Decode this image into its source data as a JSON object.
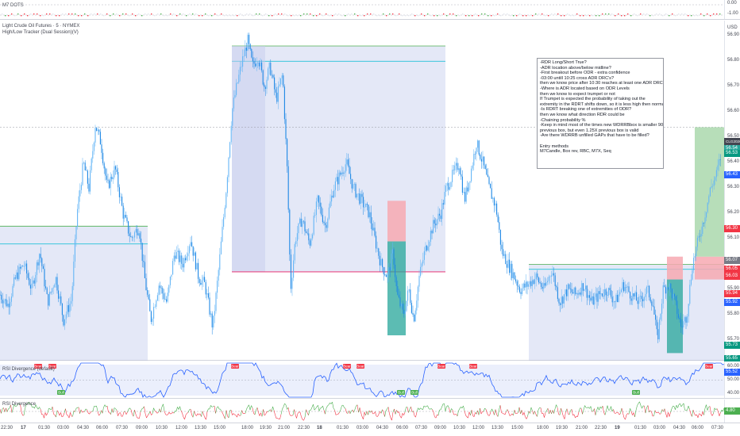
{
  "top_indicator": {
    "label": "M7 DOTS",
    "axis_ticks": [
      "0.00",
      "-1.00"
    ]
  },
  "symbol": {
    "title": "Light Crude Oil Futures · 5 · NYMEX",
    "indicator": "High/Low Tracker (Dual Session)(V)"
  },
  "price_axis": {
    "ticks": [
      "56.90",
      "56.80",
      "56.70",
      "56.60",
      "56.50",
      "56.40",
      "56.30",
      "56.20",
      "56.10",
      "56.00",
      "55.90",
      "55.80",
      "55.70"
    ],
    "unit": "USD",
    "badges": [
      {
        "text": "CLG2026",
        "color": "#434651"
      },
      {
        "text": "56.54",
        "color": "#26a69a"
      },
      {
        "text": "56.53",
        "color": "#089981"
      },
      {
        "text": "56.43",
        "color": "#2962ff"
      },
      {
        "text": "56.30",
        "color": "#f23645"
      },
      {
        "text": "56.07",
        "color": "#787b86"
      },
      {
        "text": "56.05",
        "color": "#f23645"
      },
      {
        "text": "56.03",
        "color": "#f23645"
      },
      {
        "text": "55.94",
        "color": "#f23645"
      },
      {
        "text": "55.92",
        "color": "#2962ff"
      },
      {
        "text": "55.73",
        "color": "#089981"
      },
      {
        "text": "55.65",
        "color": "#089981"
      }
    ]
  },
  "notes": [
    "-RDR Long/Short True?",
    "-ADR location above/below midline?",
    "-First breakout before ODR - extra confidence",
    "-03:00 untill 10:25 cross ADR DRC's?",
    "      then we know price after 10:30 reaches at least one ADR DRC",
    "-Where is ADR located based on ODR Levels",
    "      then we know to expect trumpet or not",
    "            If Trumpet is expected the probability of taking out the",
    "extremity in the RDRT shifts down, so it is less high then normal",
    "-Is RDRT breaking one of extremities of ODR?",
    "      then we know what direction RDR could be",
    "-Chaining probability %",
    "-Keep in mind most of the times new WDRRBbox is smaller 90% of",
    "previous box, but even 1.25X previous box is valid",
    "-Are there WDRRB unfilled GAPs that have to be filled?",
    "",
    "Entry methods",
    "M7Candle, Box rev, RBC, M7X, Seq"
  ],
  "rsi_pane": {
    "label": "RSI Divergence (default)",
    "axis_ticks": [
      "60.00",
      "50.00",
      "40.00"
    ],
    "badge_value": "55.52",
    "badge_color": "#2962ff",
    "signals": [
      {
        "text": "Bear",
        "type": "bear",
        "x": 48
      },
      {
        "text": "Bear",
        "type": "bear",
        "x": 66
      },
      {
        "text": "Bull",
        "type": "bull",
        "x": 77
      },
      {
        "text": "Bear",
        "type": "bear",
        "x": 296
      },
      {
        "text": "Bear",
        "type": "bear",
        "x": 437
      },
      {
        "text": "Bear",
        "type": "bear",
        "x": 454
      },
      {
        "text": "Bull",
        "type": "bull",
        "x": 505
      },
      {
        "text": "Bull",
        "type": "bull",
        "x": 522
      },
      {
        "text": "Bear",
        "type": "bear",
        "x": 556
      },
      {
        "text": "Bear",
        "type": "bear",
        "x": 596
      },
      {
        "text": "Bull",
        "type": "bull",
        "x": 801
      },
      {
        "text": "Bear",
        "type": "bear",
        "x": 893
      }
    ]
  },
  "rsi2_pane": {
    "label": "RSI Divergence",
    "badge_value": "4.80",
    "badge_color": "#4caf50"
  },
  "time_axis": {
    "labels": [
      {
        "text": "22:30",
        "x": 8
      },
      {
        "text": "17",
        "x": 33,
        "bold": true
      },
      {
        "text": "01:30",
        "x": 55
      },
      {
        "text": "03:00",
        "x": 79
      },
      {
        "text": "04:30",
        "x": 104
      },
      {
        "text": "06:00",
        "x": 128
      },
      {
        "text": "07:30",
        "x": 153
      },
      {
        "text": "09:00",
        "x": 178
      },
      {
        "text": "10:30",
        "x": 203
      },
      {
        "text": "12:00",
        "x": 228
      },
      {
        "text": "13:30",
        "x": 252
      },
      {
        "text": "15:00",
        "x": 276
      },
      {
        "text": "18:00",
        "x": 311
      },
      {
        "text": "19:30",
        "x": 334
      },
      {
        "text": "21:00",
        "x": 357
      },
      {
        "text": "22:30",
        "x": 382
      },
      {
        "text": "18",
        "x": 406,
        "bold": true
      },
      {
        "text": "01:30",
        "x": 431
      },
      {
        "text": "03:00",
        "x": 456
      },
      {
        "text": "04:30",
        "x": 481
      },
      {
        "text": "06:00",
        "x": 506
      },
      {
        "text": "07:30",
        "x": 530
      },
      {
        "text": "09:00",
        "x": 554
      },
      {
        "text": "10:30",
        "x": 578
      },
      {
        "text": "12:00",
        "x": 602
      },
      {
        "text": "13:30",
        "x": 626
      },
      {
        "text": "15:00",
        "x": 651
      },
      {
        "text": "18:00",
        "x": 683
      },
      {
        "text": "19:30",
        "x": 707
      },
      {
        "text": "21:00",
        "x": 732
      },
      {
        "text": "22:30",
        "x": 756
      },
      {
        "text": "19",
        "x": 781,
        "bold": true
      },
      {
        "text": "01:30",
        "x": 806
      },
      {
        "text": "03:00",
        "x": 830
      },
      {
        "text": "04:30",
        "x": 855
      },
      {
        "text": "06:00",
        "x": 878
      },
      {
        "text": "07:30",
        "x": 903
      }
    ]
  },
  "chart_data": {
    "type": "candlestick",
    "instrument": "CLG2026",
    "timeframe": "5",
    "ylim": [
      55.62,
      56.96
    ],
    "price_path": [
      [
        0,
        55.88
      ],
      [
        10,
        55.84
      ],
      [
        20,
        55.95
      ],
      [
        30,
        56.0
      ],
      [
        40,
        55.9
      ],
      [
        50,
        56.05
      ],
      [
        60,
        55.85
      ],
      [
        70,
        55.95
      ],
      [
        80,
        55.78
      ],
      [
        90,
        55.86
      ],
      [
        97,
        56.2
      ],
      [
        105,
        56.4
      ],
      [
        112,
        56.3
      ],
      [
        120,
        56.55
      ],
      [
        127,
        56.48
      ],
      [
        135,
        56.3
      ],
      [
        145,
        56.38
      ],
      [
        155,
        56.2
      ],
      [
        165,
        56.1
      ],
      [
        175,
        56.15
      ],
      [
        182,
        55.95
      ],
      [
        190,
        55.78
      ],
      [
        200,
        55.92
      ],
      [
        210,
        55.85
      ],
      [
        220,
        56.05
      ],
      [
        230,
        56.0
      ],
      [
        240,
        56.1
      ],
      [
        250,
        55.95
      ],
      [
        258,
        55.92
      ],
      [
        268,
        55.75
      ],
      [
        276,
        56.0
      ],
      [
        285,
        56.3
      ],
      [
        292,
        56.6
      ],
      [
        298,
        56.7
      ],
      [
        305,
        56.8
      ],
      [
        312,
        56.88
      ],
      [
        318,
        56.78
      ],
      [
        325,
        56.82
      ],
      [
        333,
        56.7
      ],
      [
        340,
        56.78
      ],
      [
        348,
        56.65
      ],
      [
        356,
        56.75
      ],
      [
        362,
        56.35
      ],
      [
        366,
        55.9
      ],
      [
        372,
        56.1
      ],
      [
        380,
        56.18
      ],
      [
        390,
        56.08
      ],
      [
        400,
        56.25
      ],
      [
        410,
        56.15
      ],
      [
        420,
        56.3
      ],
      [
        428,
        56.35
      ],
      [
        436,
        56.4
      ],
      [
        445,
        56.3
      ],
      [
        455,
        56.25
      ],
      [
        465,
        56.2
      ],
      [
        472,
        56.1
      ],
      [
        480,
        56.0
      ],
      [
        488,
        55.95
      ],
      [
        495,
        56.05
      ],
      [
        500,
        55.88
      ],
      [
        508,
        55.8
      ],
      [
        515,
        55.9
      ],
      [
        521,
        55.78
      ],
      [
        528,
        55.95
      ],
      [
        535,
        56.05
      ],
      [
        545,
        56.15
      ],
      [
        555,
        56.2
      ],
      [
        562,
        56.3
      ],
      [
        570,
        56.35
      ],
      [
        578,
        56.4
      ],
      [
        585,
        56.25
      ],
      [
        592,
        56.35
      ],
      [
        600,
        56.48
      ],
      [
        608,
        56.4
      ],
      [
        616,
        56.3
      ],
      [
        625,
        56.22
      ],
      [
        632,
        56.05
      ],
      [
        640,
        56.0
      ],
      [
        648,
        55.95
      ],
      [
        655,
        55.9
      ],
      [
        665,
        55.92
      ],
      [
        675,
        55.95
      ],
      [
        685,
        55.9
      ],
      [
        695,
        55.98
      ],
      [
        705,
        55.85
      ],
      [
        715,
        55.9
      ],
      [
        725,
        55.88
      ],
      [
        735,
        55.92
      ],
      [
        745,
        55.85
      ],
      [
        755,
        55.88
      ],
      [
        765,
        55.9
      ],
      [
        775,
        55.85
      ],
      [
        785,
        55.92
      ],
      [
        795,
        55.88
      ],
      [
        805,
        55.85
      ],
      [
        815,
        55.9
      ],
      [
        822,
        55.85
      ],
      [
        828,
        55.7
      ],
      [
        835,
        55.9
      ],
      [
        842,
        55.92
      ],
      [
        850,
        55.85
      ],
      [
        858,
        55.75
      ],
      [
        865,
        55.8
      ],
      [
        872,
        56.0
      ],
      [
        880,
        56.1
      ],
      [
        888,
        56.2
      ],
      [
        895,
        56.3
      ],
      [
        902,
        56.35
      ],
      [
        908,
        56.43
      ]
    ],
    "sessions": [
      {
        "x0": 0,
        "x1": 186,
        "high": 56.15,
        "low": 55.62,
        "mid": 56.08
      },
      {
        "x0": 292,
        "x1": 561,
        "high": 56.86,
        "low": 55.97,
        "mid": 56.8
      },
      {
        "x0": 666,
        "x1": 912,
        "high": 56.0,
        "low": 55.62,
        "mid": 55.98
      }
    ],
    "trades": [
      {
        "x0": 488,
        "x1": 511,
        "entry": 56.09,
        "stop": 56.25,
        "target": 55.72
      },
      {
        "x0": 840,
        "x1": 860,
        "entry": 55.94,
        "stop": 56.03,
        "target": 55.65
      },
      {
        "x0": 875,
        "x1": 912,
        "entry": 56.03,
        "stop": 55.94,
        "target": 56.54
      }
    ],
    "rsi_ylim": [
      38,
      62
    ],
    "rsi2_ylim": [
      -10,
      10
    ]
  }
}
